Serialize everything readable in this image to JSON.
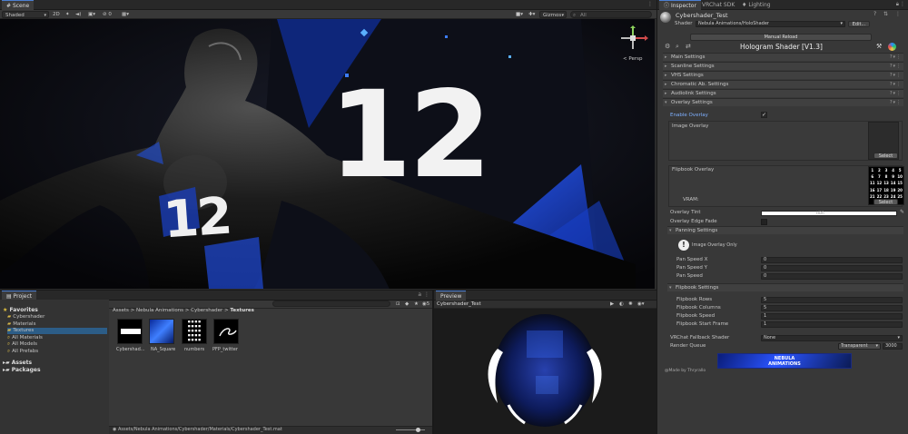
{
  "scene": {
    "tab": "Scene",
    "toolbar": {
      "shading": "Shaded",
      "mode_2d": "2D",
      "count": "0",
      "gizmos": "Gizmos",
      "search": "All"
    },
    "persp": "< Persp",
    "viewport_numbers": [
      "12",
      "12"
    ]
  },
  "inspector": {
    "tabs": [
      "Inspector",
      "VRChat SDK",
      "Lighting"
    ],
    "material_name": "Cybershader_Test",
    "shader_label": "Shader",
    "shader_value": "Nebula Animations/HoloShader",
    "manual_reload": "Manual Reload",
    "title": "Hologram Shader [V1.3]",
    "sections": [
      "Main Settings",
      "Scanline Settings",
      "VHS Settings",
      "Chromatic Ab. Settings",
      "Audiolink Settings",
      "Overlay Settings"
    ],
    "enable_overlay": "Enable Overlay",
    "image_overlay": "Image Overlay",
    "select": "Select",
    "flipbook_overlay": "Flipbook Overlay",
    "vram": "VRAM:",
    "overlay_tint": "Overlay Tint",
    "overlay_edge_fade": "Overlay Edge Fade",
    "panning_settings": "Panning Settings",
    "image_overlay_only": "Image Overlay Only",
    "pan_rows": [
      {
        "label": "Pan Speed X",
        "value": "0"
      },
      {
        "label": "Pan Speed Y",
        "value": "0"
      },
      {
        "label": "Pan Speed",
        "value": "0"
      }
    ],
    "flipbook_settings": "Flipbook Settings",
    "flip_rows": [
      {
        "label": "Flipbook Rows",
        "value": "5"
      },
      {
        "label": "Flipbook Columns",
        "value": "5"
      },
      {
        "label": "Flipbook Speed",
        "value": "1"
      },
      {
        "label": "Flipbook Start Frame",
        "value": "1"
      }
    ],
    "fallback_label": "VRChat Fallback Shader",
    "fallback_value": "None",
    "render_queue_label": "Render Queue",
    "render_queue_mode": "Transparent",
    "render_queue_value": "3000",
    "banner_line1": "NEBULA",
    "banner_line2": "ANIMATIONS",
    "credit": "@Made by Thryrallo",
    "grid_numbers": [
      "1",
      "2",
      "3",
      "4",
      "5",
      "6",
      "7",
      "8",
      "9",
      "10",
      "11",
      "12",
      "13",
      "14",
      "15",
      "16",
      "17",
      "18",
      "19",
      "20",
      "21",
      "22",
      "23",
      "24",
      "25"
    ]
  },
  "project": {
    "tab": "Project",
    "favorites_label": "Favorites",
    "favorites": [
      "Cybershader",
      "Materials",
      "Textures",
      "All Materials",
      "All Models",
      "All Prefabs"
    ],
    "roots": [
      "Assets",
      "Packages"
    ],
    "breadcrumb": [
      "Assets",
      "Nebula Animations",
      "Cybershader",
      "Textures"
    ],
    "assets": [
      "Cybershad...",
      "NA_Square",
      "numbers",
      "PFP_twitter"
    ],
    "status_path": "Assets/Nebula Animations/Cybershader/Materials/Cybershader_Test.mat",
    "asset_count": "5"
  },
  "preview": {
    "tab": "Preview",
    "name": "Cybershader_Test"
  },
  "colors": {
    "accent": "#4c7fd1",
    "blue_glow": "#1a44c8",
    "panel": "#383838"
  }
}
